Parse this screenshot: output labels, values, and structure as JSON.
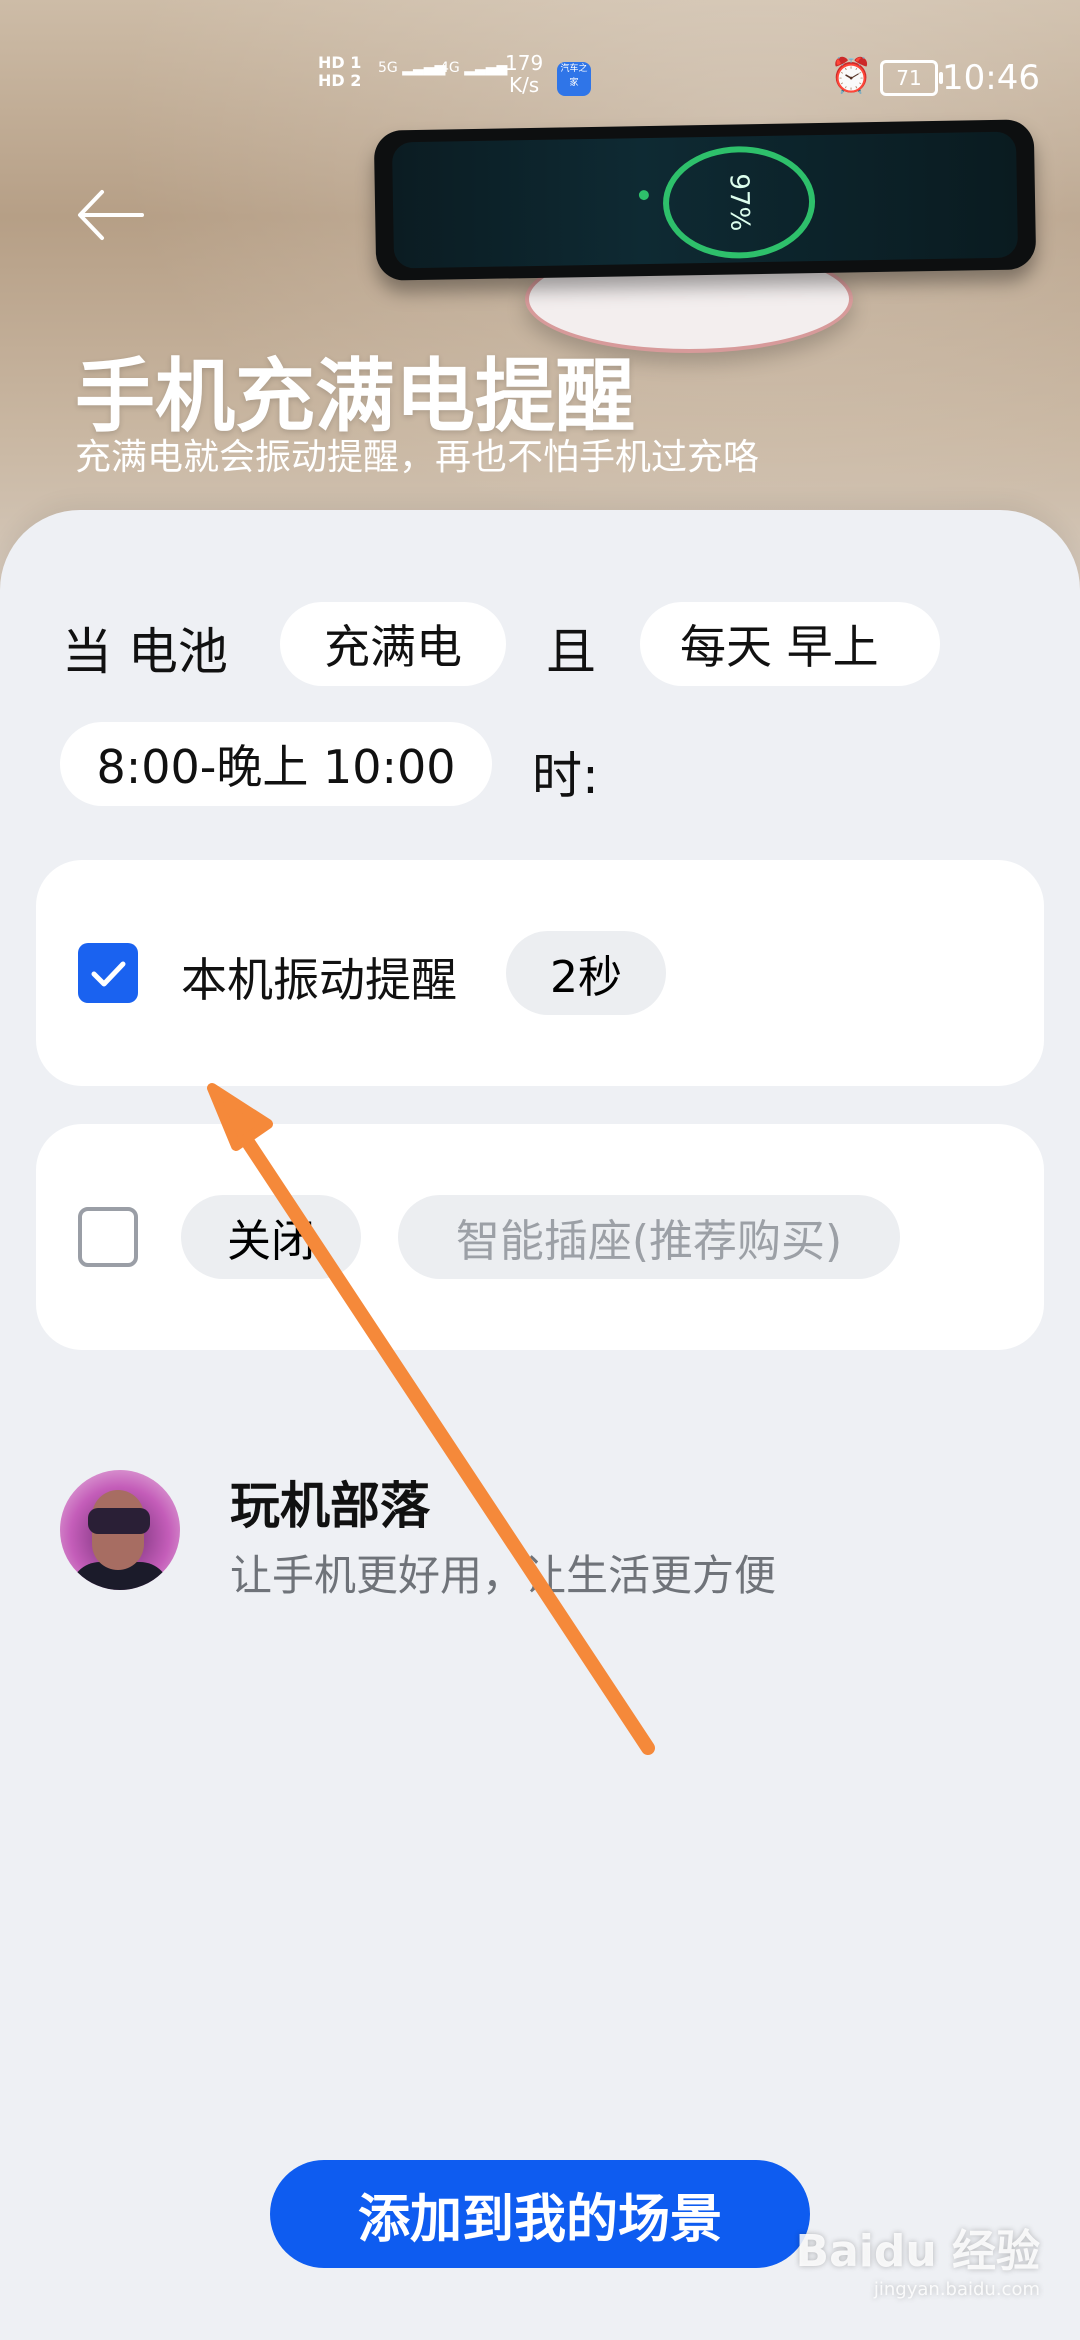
{
  "status_bar": {
    "net_hd1": "HD 1",
    "net_hd2": "HD 2",
    "net_5g": "5G",
    "net_4g": "4G",
    "speed_value": "179",
    "speed_unit": "K/s",
    "app_icon_text": "汽车之家",
    "alarm_icon": "alarm-clock-icon",
    "battery": "71",
    "time": "10:46"
  },
  "header": {
    "back_icon": "back-arrow-icon",
    "title": "手机充满电提醒",
    "subtitle": "充满电就会振动提醒，再也不怕手机过充咯"
  },
  "hero_image": {
    "phone_screen_percent": "97%"
  },
  "condition": {
    "prefix": "当 电池",
    "battery_state": "充满电",
    "and": "且",
    "time_range_part1": "每天 早上",
    "time_range_part2": "8:00-晚上 10:00",
    "suffix": "时:"
  },
  "actions": [
    {
      "checked": true,
      "label": "本机振动提醒",
      "option": "2秒"
    },
    {
      "checked": false,
      "label": "关闭",
      "option": "智能插座(推荐购买)"
    }
  ],
  "author": {
    "name": "玩机部落",
    "tagline": "让手机更好用，让生活更方便"
  },
  "add_button": "添加到我的场景",
  "watermark": {
    "brand": "Baidu 经验",
    "url": "jingyan.baidu.com"
  },
  "colors": {
    "accent": "#0e5cf0",
    "annotation_arrow": "#f5893a"
  }
}
